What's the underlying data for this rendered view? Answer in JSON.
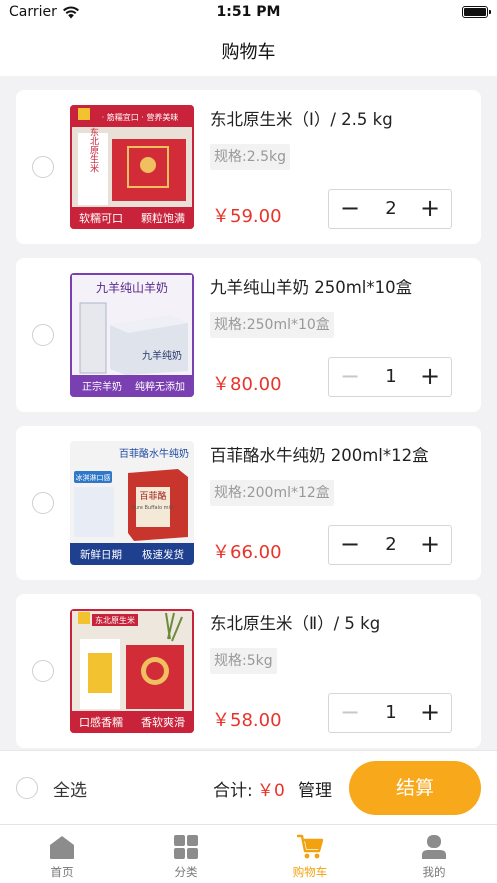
{
  "status_bar": {
    "carrier": "Carrier",
    "time": "1:51 PM"
  },
  "nav": {
    "title": "购物车"
  },
  "items": [
    {
      "name": "东北原生米（Ⅰ）/ 2.5 kg",
      "spec": "规格:2.5kg",
      "price": "￥59.00",
      "qty": "2",
      "thumb": {
        "banner_left": "软糯可口",
        "banner_right": "颗粒饱满",
        "top_tags": "· 筋糯宜口 · 营养美味",
        "box_text": "东北原生米"
      }
    },
    {
      "name": "九羊纯山羊奶 250ml*10盒",
      "spec": "规格:250ml*10盒",
      "price": "￥80.00",
      "qty": "1",
      "thumb": {
        "title": "九羊纯山羊奶",
        "banner_left": "正宗羊奶",
        "banner_right": "纯粹无添加",
        "box_text": "九羊纯奶"
      }
    },
    {
      "name": "百菲酪水牛纯奶 200ml*12盒",
      "spec": "规格:200ml*12盒",
      "price": "￥66.00",
      "qty": "2",
      "thumb": {
        "title": "百菲酪水牛纯奶",
        "tag": "冰淇淋口感",
        "banner_left": "新鲜日期",
        "banner_right": "极速发货",
        "box_text": "百菲酪",
        "box_sub": "Pure Buffalo milk"
      }
    },
    {
      "name": "东北原生米（Ⅱ）/ 5 kg",
      "spec": "规格:5kg",
      "price": "￥58.00",
      "qty": "1",
      "thumb": {
        "title": "东北原生米",
        "banner_left": "口感香糯",
        "banner_right": "香软爽滑"
      }
    }
  ],
  "footer": {
    "select_all": "全选",
    "total_label": "合计:",
    "total_value": "￥0",
    "manage": "管理",
    "checkout": "结算"
  },
  "tabbar": [
    {
      "label": "首页",
      "icon": "home-icon"
    },
    {
      "label": "分类",
      "icon": "grid-icon"
    },
    {
      "label": "购物车",
      "icon": "cart-icon"
    },
    {
      "label": "我的",
      "icon": "user-icon"
    }
  ],
  "colors": {
    "accent": "#f7a81b",
    "price": "#e8342a",
    "tab_active": "#f2a20e"
  }
}
